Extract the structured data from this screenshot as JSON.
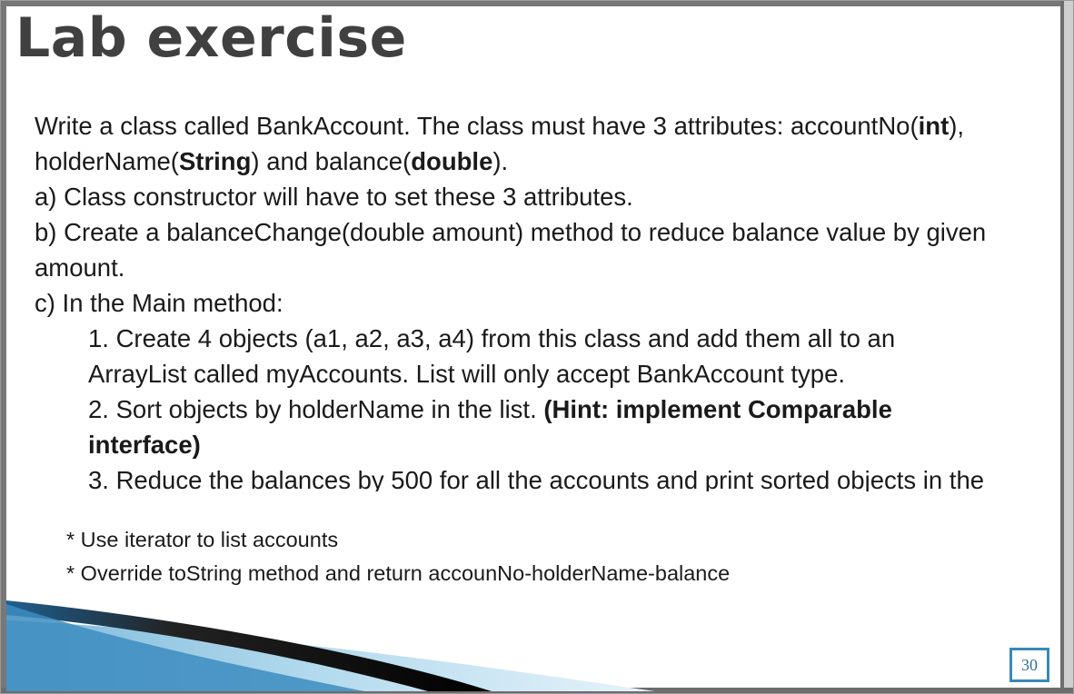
{
  "slide": {
    "title": "Lab exercise",
    "line1_a": "Write a class called BankAccount. The class must have 3 attributes: accountNo(",
    "line1_b": "int",
    "line1_c": "),",
    "line2_a": "holderName(",
    "line2_b": "String",
    "line2_c": ") and balance(",
    "line2_d": "double",
    "line2_e": ").",
    "item_a": "a) Class constructor will have to set these 3 attributes.",
    "item_b1": "b) Create a balanceChange(double amount) method to reduce balance value by given",
    "item_b2": "amount.",
    "item_c": "c) In the Main method:",
    "sub1_line1": "1. Create 4 objects (a1, a2, a3, a4) from this class and add them all to an",
    "sub1_line2": "ArrayList called myAccounts. List will only accept BankAccount type.",
    "sub2_a": "2. Sort objects by holderName in the list. ",
    "sub2_b": "(Hint: implement Comparable",
    "sub2_c": "interface)",
    "sub3": "3. Reduce the balances by 500 for all the accounts and print sorted objects in the",
    "note1": "* Use iterator to list accounts",
    "note2": "* Override toString method and return accounNo-holderName-balance",
    "page_number": "30"
  },
  "colors": {
    "title": "#404040",
    "text": "#1a1a1a",
    "accent_blue": "#3a88b8",
    "stripe_light": "#a9d3ea",
    "stripe_dark": "#000000"
  }
}
